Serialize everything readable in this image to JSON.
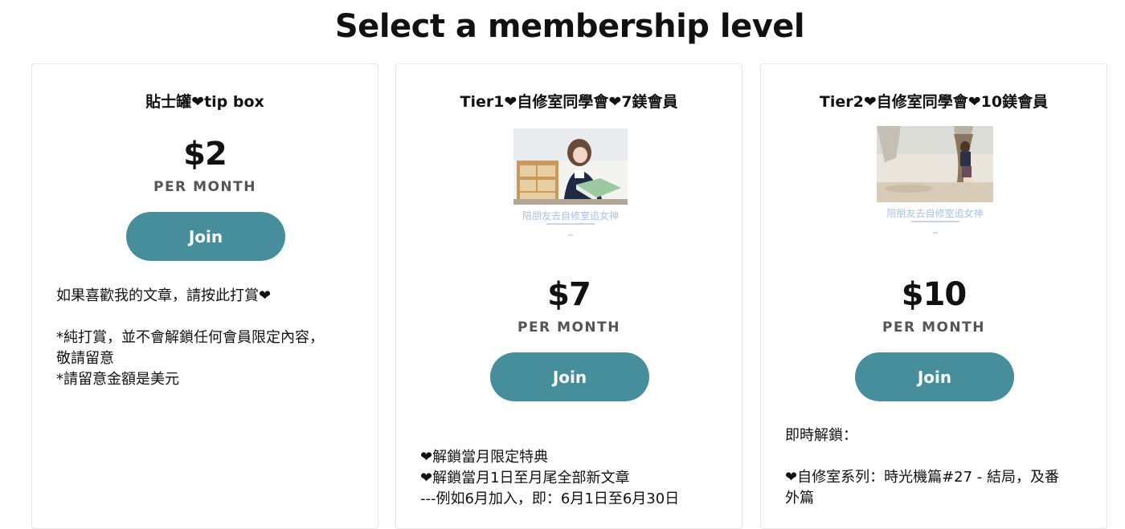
{
  "page": {
    "title": "Select a membership level"
  },
  "tiers": [
    {
      "name": "貼士罐❤tip box",
      "price": "$2",
      "period": "PER MONTH",
      "button_label": "Join",
      "description": "如果喜歡我的文章，請按此打賞❤\n\n*純打賞，並不會解鎖任何會員限定內容，\n敬請留意\n*請留意金額是美元"
    },
    {
      "name": "Tier1❤自修室同學會❤7鎂會員",
      "image_caption": "陪朋友去自修室追女神",
      "price": "$7",
      "period": "PER MONTH",
      "button_label": "Join",
      "description": "❤解鎖當月限定特典\n❤解鎖當月1日至月尾全部新文章\n---例如6月加入，即：6月1日至6月30日"
    },
    {
      "name": "Tier2❤自修室同學會❤10鎂會員",
      "image_caption": "陪朋友去自修室追女神",
      "price": "$10",
      "period": "PER MONTH",
      "button_label": "Join",
      "description": "即時解鎖：\n\n❤自修室系列：時光機篇#27 - 結局，及番\n外篇"
    }
  ],
  "colors": {
    "button": "#468e9c",
    "card_border": "#e5e5e5"
  }
}
